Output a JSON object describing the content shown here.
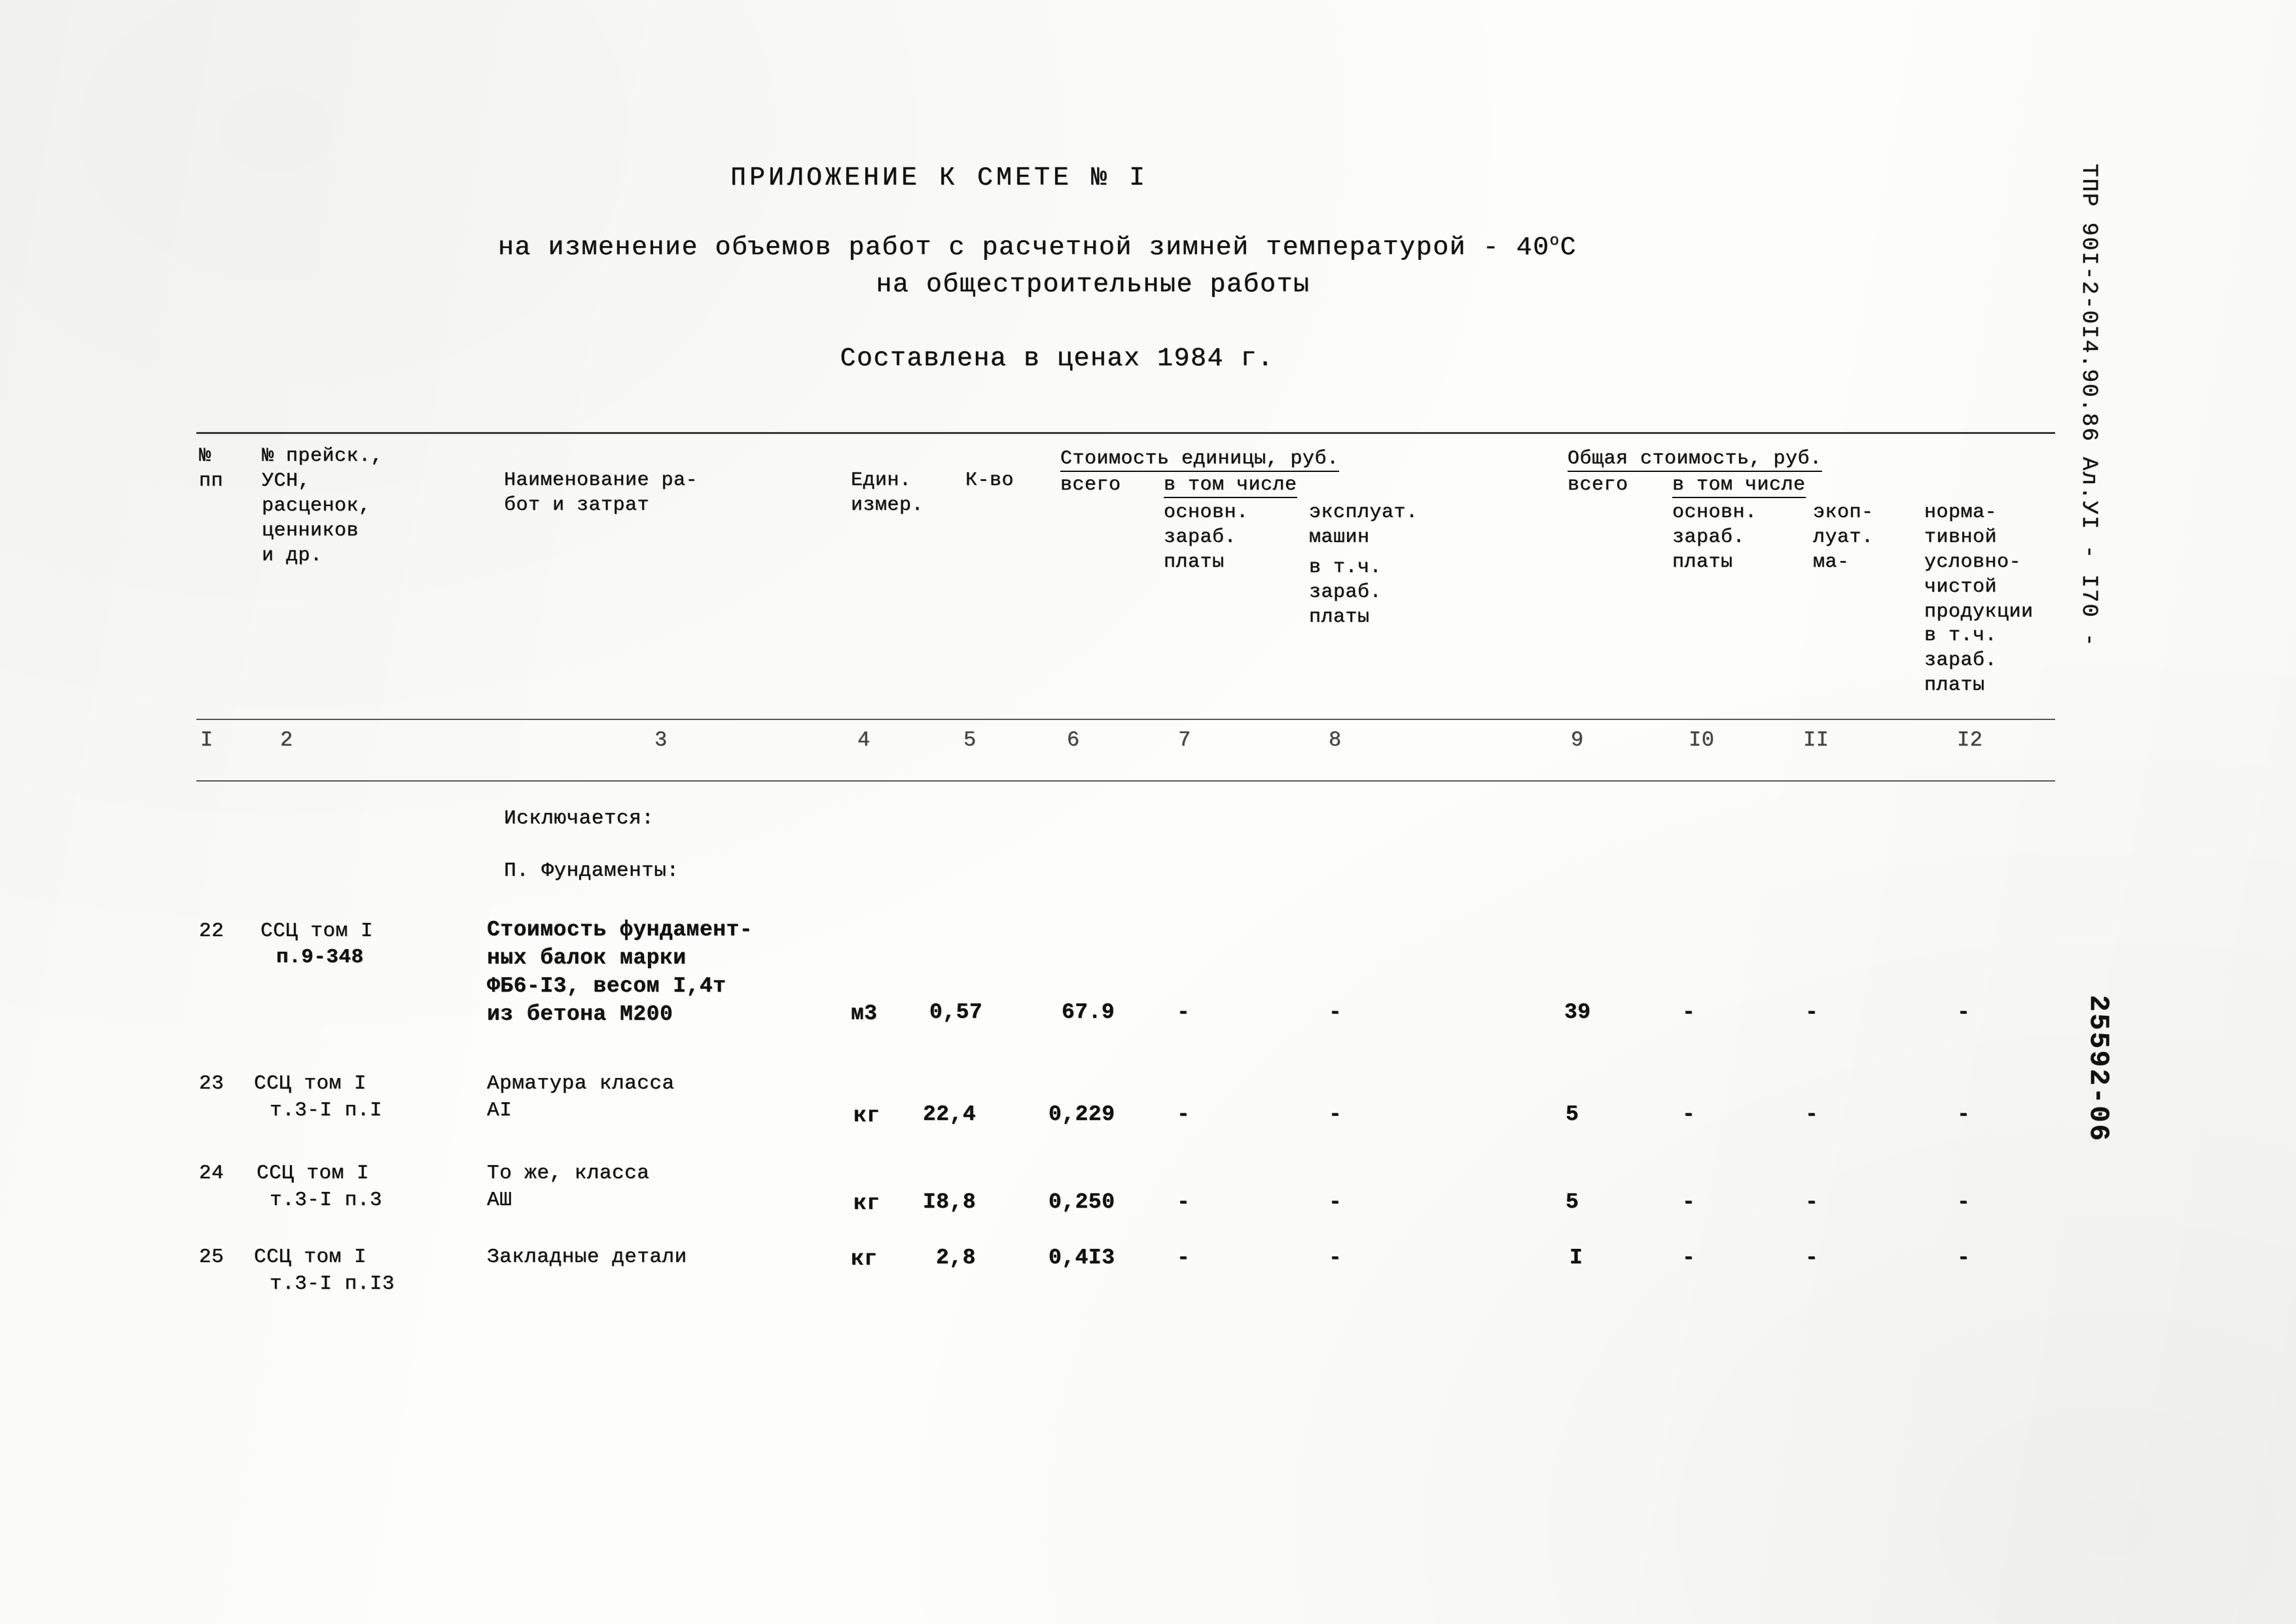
{
  "document": {
    "title_main": "ПРИЛОЖЕНИЕ К СМЕТЕ № I",
    "subtitle_line1": "на изменение объемов работ с расчетной зимней температурой - 40",
    "subtitle_degree": "о",
    "subtitle_celsius": "С",
    "subtitle_line2": "на общестроительные работы",
    "prices_note": "Составлена в ценах 1984 г."
  },
  "margin": {
    "code": "ТПР 90I-2-0I4.90.86   Ал.УI   - I70 -",
    "archive_id": "25592-06"
  },
  "table": {
    "header": {
      "col1": "№\nпп",
      "col2": "№ прейск.,\nУСН,\nрасценок,\nценников\nи др.",
      "col3": "Наименование ра-\nбот и затрат",
      "col4": "Един.\nизмер.",
      "col5": "К-во",
      "group_unit_cost": "Стоимость единицы, руб.",
      "group_total_cost": "Общая стоимость, руб.",
      "unit_total": "всего",
      "unit_among": "в том числе",
      "unit_basic_wage": "основн.\nзараб.\nплаты",
      "unit_machines": "эксплуат.\nмашин",
      "unit_machines_sub": "в т.ч.\nзараб.\nплаты",
      "total_total": "всего",
      "total_among": "в том числе",
      "total_basic_wage": "основн.\nзараб.\nплаты",
      "total_machines": "экоп-\nлуат.\nма-",
      "total_nchp": "норма-\nтивной\nусловно-\nчистой\nпродукции",
      "total_nchp_sub": "в т.ч.\nзараб.\nплаты"
    },
    "column_numbers": [
      "I",
      "2",
      "3",
      "4",
      "5",
      "6",
      "7",
      "8",
      "9",
      "I0",
      "II",
      "I2"
    ],
    "section_labels": {
      "excluded": "Исключается:",
      "section_2": "П. Фундаменты:"
    },
    "rows": [
      {
        "no": "22",
        "code_line1": "ССЦ том I",
        "code_line2": "п.9-348",
        "desc_lines": [
          "Стоимость фундамент-",
          "ных балок марки",
          "ФБ6-I3, весом I,4т",
          "из бетона М200"
        ],
        "unit": "м3",
        "qty": "0,57",
        "c6": "67.9",
        "c7": "-",
        "c8": "-",
        "c9": "39",
        "c10": "-",
        "c11": "-",
        "c12": "-"
      },
      {
        "no": "23",
        "code_line1": "ССЦ том I",
        "code_line2": "т.3-I п.I",
        "desc_lines": [
          "Арматура класса",
          "AI"
        ],
        "unit": "кг",
        "qty": "22,4",
        "c6": "0,229",
        "c7": "-",
        "c8": "-",
        "c9": "5",
        "c10": "-",
        "c11": "-",
        "c12": "-"
      },
      {
        "no": "24",
        "code_line1": "ССЦ том I",
        "code_line2": "т.3-I п.3",
        "desc_lines": [
          "То же, класса",
          "AШ"
        ],
        "unit": "кг",
        "qty": "I8,8",
        "c6": "0,250",
        "c7": "-",
        "c8": "-",
        "c9": "5",
        "c10": "-",
        "c11": "-",
        "c12": "-"
      },
      {
        "no": "25",
        "code_line1": "ССЦ том I",
        "code_line2": "т.3-I п.I3",
        "desc_lines": [
          "Закладные детали"
        ],
        "unit": "кг",
        "qty": "2,8",
        "c6": "0,4I3",
        "c7": "-",
        "c8": "-",
        "c9": "I",
        "c10": "-",
        "c11": "-",
        "c12": "-"
      }
    ]
  }
}
